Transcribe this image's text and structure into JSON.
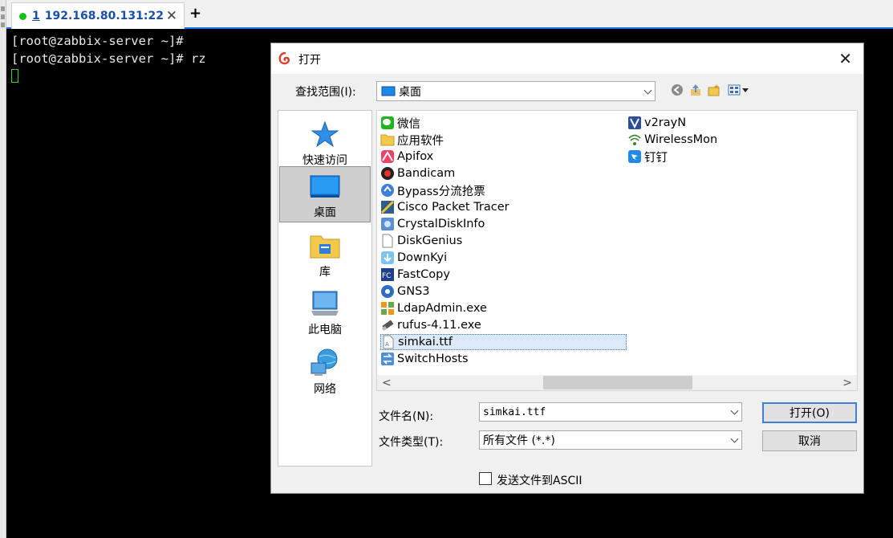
{
  "tab": {
    "number": "1",
    "host": "192.168.80.131:22",
    "status_color": "#12c212"
  },
  "terminal": {
    "lines": [
      "[root@zabbix-server ~]#",
      "[root@zabbix-server ~]# rz"
    ],
    "cursor_color": "#2bd62b"
  },
  "dialog": {
    "title": "打开",
    "lookin_label": "查找范围(I):",
    "lookin_value": "桌面",
    "places": [
      {
        "label": "快速访问",
        "icon": "star-icon"
      },
      {
        "label": "桌面",
        "icon": "desktop-icon"
      },
      {
        "label": "库",
        "icon": "folder-library-icon"
      },
      {
        "label": "此电脑",
        "icon": "computer-icon"
      },
      {
        "label": "网络",
        "icon": "network-icon"
      }
    ],
    "files": [
      {
        "name": "微信",
        "icon": "wechat-icon"
      },
      {
        "name": "应用软件",
        "icon": "folder-icon"
      },
      {
        "name": "Apifox",
        "icon": "shortcut-icon"
      },
      {
        "name": "Bandicam",
        "icon": "shortcut-icon"
      },
      {
        "name": "Bypass分流抢票",
        "icon": "shortcut-icon"
      },
      {
        "name": "Cisco Packet Tracer",
        "icon": "shortcut-icon"
      },
      {
        "name": "CrystalDiskInfo",
        "icon": "shortcut-icon"
      },
      {
        "name": "DiskGenius",
        "icon": "file-icon"
      },
      {
        "name": "DownKyi",
        "icon": "shortcut-icon"
      },
      {
        "name": "FastCopy",
        "icon": "shortcut-icon"
      },
      {
        "name": "GNS3",
        "icon": "shortcut-icon"
      },
      {
        "name": "LdapAdmin.exe",
        "icon": "exe-icon"
      },
      {
        "name": "rufus-4.11.exe",
        "icon": "usb-icon"
      },
      {
        "name": "simkai.ttf",
        "icon": "font-file-icon",
        "selected": true
      },
      {
        "name": "SwitchHosts",
        "icon": "shortcut-icon"
      },
      {
        "name": "v2rayN",
        "icon": "shortcut-icon"
      },
      {
        "name": "WirelessMon",
        "icon": "shortcut-icon"
      },
      {
        "name": "钉钉",
        "icon": "shortcut-icon"
      }
    ],
    "filename_label": "文件名(N):",
    "filename_value": "simkai.ttf",
    "filetype_label": "文件类型(T):",
    "filetype_value": "所有文件 (*.*)",
    "open_button": "打开(O)",
    "cancel_button": "取消",
    "ascii_checkbox_label": "发送文件到ASCII",
    "ascii_checked": false,
    "accent_color": "#3c7fd4"
  }
}
